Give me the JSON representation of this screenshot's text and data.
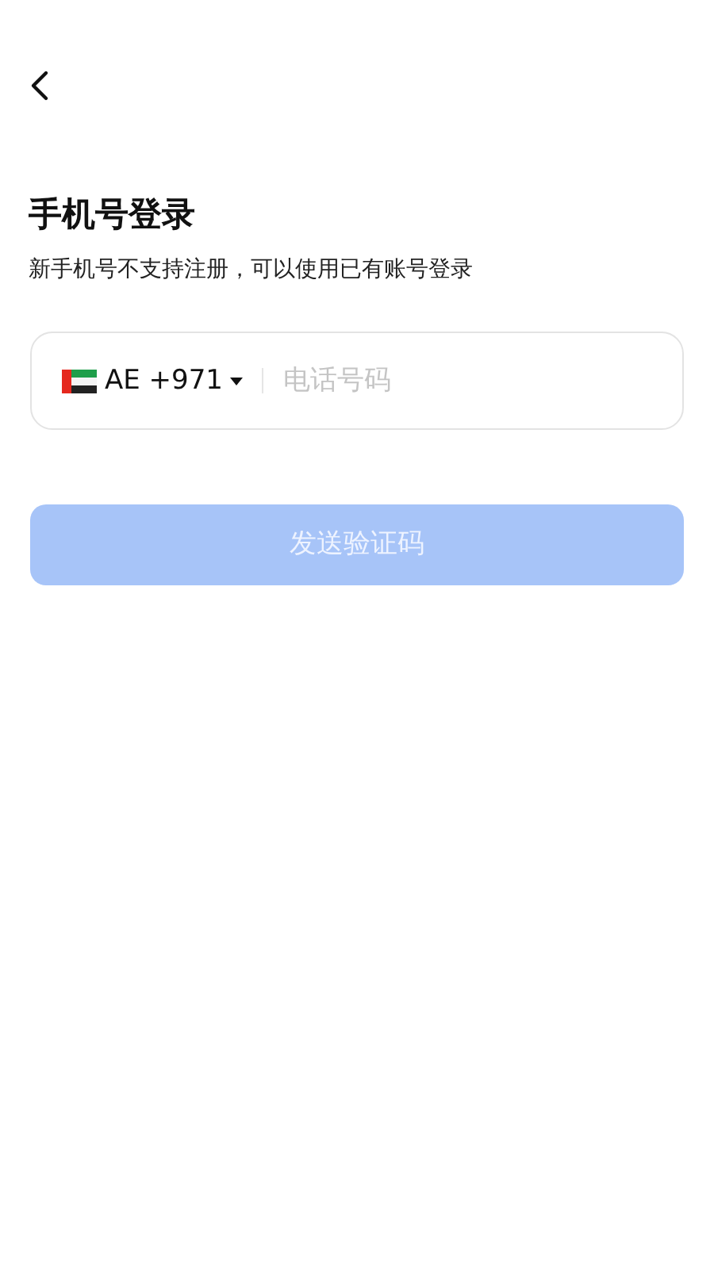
{
  "title": "手机号登录",
  "subtitle": "新手机号不支持注册，可以使用已有账号登录",
  "phone_field": {
    "country_code": "AE +971",
    "placeholder": "电话号码"
  },
  "send_button": {
    "label": "发送验证码",
    "disabled": true
  }
}
